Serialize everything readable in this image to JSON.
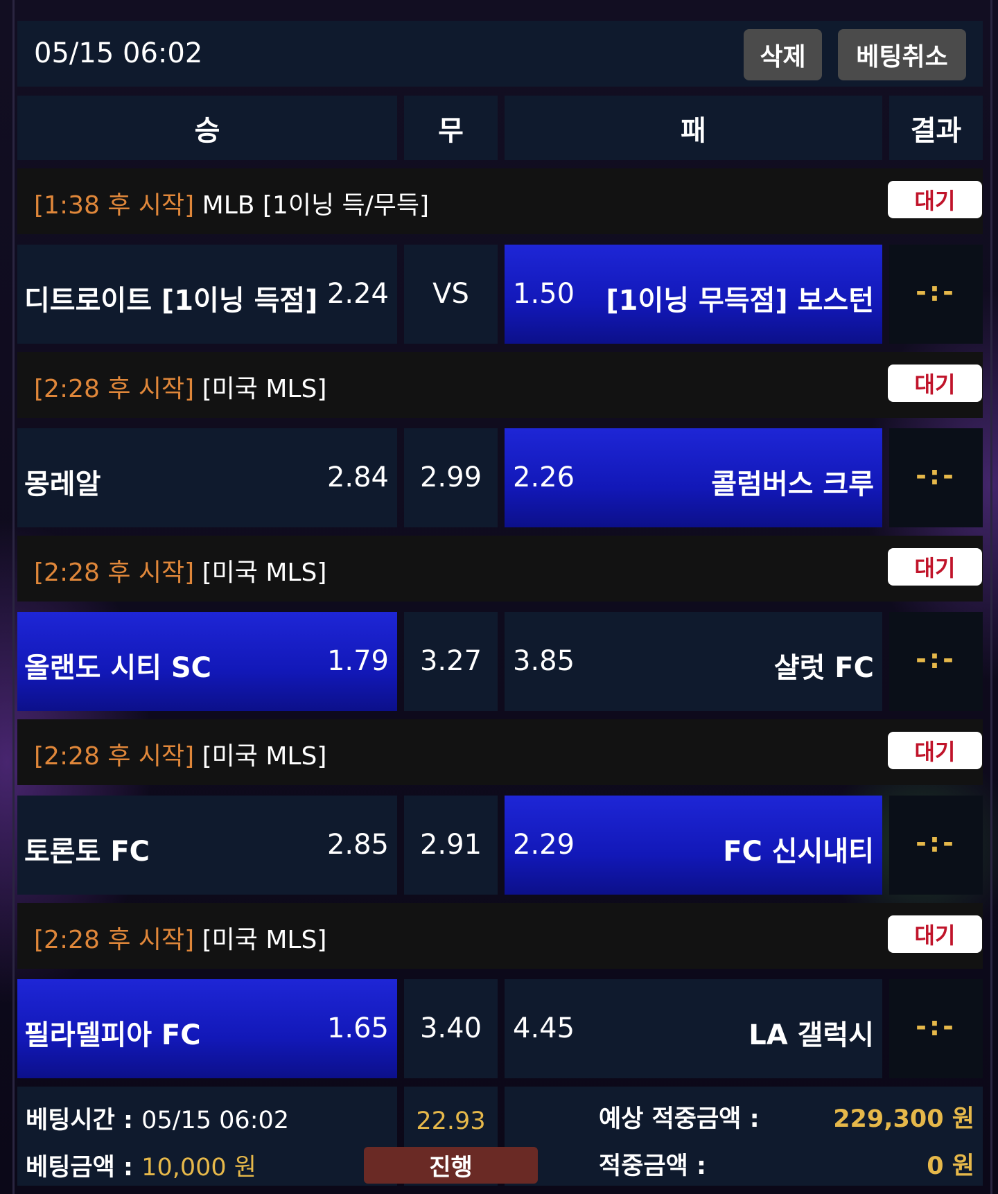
{
  "header": {
    "datetime": "05/15 06:02",
    "delete_label": "삭제",
    "cancel_bet_label": "베팅취소"
  },
  "columns": {
    "win": "승",
    "draw": "무",
    "lose": "패",
    "result": "결과"
  },
  "matches": [
    {
      "start": "[1:38 후 시작]",
      "league": "MLB [1이닝 득/무득]",
      "status": "대기",
      "home": "디트로이트 [1이닝 득점]",
      "home_odds": "2.24",
      "draw": "VS",
      "away_odds": "1.50",
      "away": "[1이닝 무득점] 보스턴",
      "selected": "away",
      "score": "-:-"
    },
    {
      "start": "[2:28 후 시작]",
      "league": "[미국 MLS]",
      "status": "대기",
      "home": "몽레알",
      "home_odds": "2.84",
      "draw": "2.99",
      "away_odds": "2.26",
      "away": "콜럼버스 크루",
      "selected": "away",
      "score": "-:-"
    },
    {
      "start": "[2:28 후 시작]",
      "league": "[미국 MLS]",
      "status": "대기",
      "home": "올랜도 시티 SC",
      "home_odds": "1.79",
      "draw": "3.27",
      "away_odds": "3.85",
      "away": "샬럿 FC",
      "selected": "home",
      "score": "-:-"
    },
    {
      "start": "[2:28 후 시작]",
      "league": "[미국 MLS]",
      "status": "대기",
      "home": "토론토 FC",
      "home_odds": "2.85",
      "draw": "2.91",
      "away_odds": "2.29",
      "away": "FC 신시내티",
      "selected": "away",
      "score": "-:-"
    },
    {
      "start": "[2:28 후 시작]",
      "league": "[미국 MLS]",
      "status": "대기",
      "home": "필라델피아 FC",
      "home_odds": "1.65",
      "draw": "3.40",
      "away_odds": "4.45",
      "away": "LA 갤럭시",
      "selected": "home",
      "score": "-:-"
    }
  ],
  "summary": {
    "bet_time_label": "베팅시간 :",
    "bet_time": "05/15 06:02",
    "bet_amount_label": "베팅금액 :",
    "bet_amount": "10,000 원",
    "total_odds": "22.93",
    "progress_label": "진행",
    "expected_win_label": "예상 적중금액 :",
    "expected_win": "229,300 원",
    "win_amount_label": "적중금액 :",
    "win_amount": "0 원"
  },
  "colors": {
    "selected_blue": "#1e26d6",
    "status_red": "#c0142a",
    "accent_orange": "#e0873a",
    "accent_gold": "#e6b84a"
  }
}
